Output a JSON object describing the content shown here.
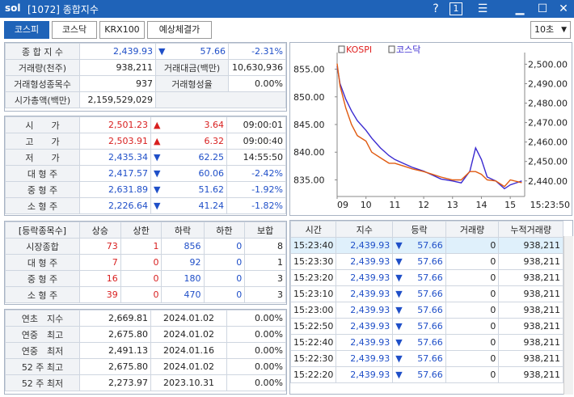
{
  "window": {
    "logo": "sol",
    "title": "[1072] 종합지수",
    "help": "?",
    "page_indicator": "1"
  },
  "tabs": [
    {
      "label": "코스피",
      "active": true
    },
    {
      "label": "코스닥"
    },
    {
      "label": "KRX100"
    },
    {
      "label": "예상체결가"
    }
  ],
  "interval": {
    "selected": "10초"
  },
  "summary": {
    "row1": {
      "label": "종 합 지 수",
      "value": "2,439.93",
      "change": "57.66",
      "rate": "-2.31%"
    },
    "row2": {
      "label1": "거래량(천주)",
      "value1": "938,211",
      "label2": "거래대금(백만)",
      "value2": "10,630,936"
    },
    "row3": {
      "label1": "거래형성종목수",
      "value1": "937",
      "label2": "거래형성율",
      "value2": "0.00%"
    },
    "row4": {
      "label": "시가총액(백만)",
      "value": "2,159,529,029"
    }
  },
  "ohlc": [
    {
      "label": "시　　가",
      "value": "2,501.23",
      "dir": "up",
      "change": "3.64",
      "extra": "09:00:01"
    },
    {
      "label": "고　　가",
      "value": "2,503.91",
      "dir": "up",
      "change": "6.32",
      "extra": "09:00:40"
    },
    {
      "label": "저　　가",
      "value": "2,435.34",
      "dir": "down",
      "change": "62.25",
      "extra": "14:55:50"
    },
    {
      "label": "대 형 주",
      "value": "2,417.57",
      "dir": "down",
      "change": "60.06",
      "extra": "-2.42%"
    },
    {
      "label": "중 형 주",
      "value": "2,631.89",
      "dir": "down",
      "change": "51.62",
      "extra": "-1.92%"
    },
    {
      "label": "소 형 주",
      "value": "2,226.64",
      "dir": "down",
      "change": "41.24",
      "extra": "-1.82%"
    }
  ],
  "breadth": {
    "headers": [
      "[등락종목수]",
      "상승",
      "상한",
      "하락",
      "하한",
      "보합"
    ],
    "rows": [
      [
        "시장종합",
        "73",
        "1",
        "856",
        "0",
        "8"
      ],
      [
        "대 형 주",
        "7",
        "0",
        "92",
        "0",
        "1"
      ],
      [
        "중 형 주",
        "16",
        "0",
        "180",
        "0",
        "3"
      ],
      [
        "소 형 주",
        "39",
        "0",
        "470",
        "0",
        "3"
      ]
    ]
  },
  "yearly": [
    {
      "label": "연초　지수",
      "value": "2,669.81",
      "date": "2024.01.02",
      "rate": "0.00%"
    },
    {
      "label": "연중　최고",
      "value": "2,675.80",
      "date": "2024.01.02",
      "rate": "0.00%"
    },
    {
      "label": "연중　최저",
      "value": "2,491.13",
      "date": "2024.01.16",
      "rate": "0.00%"
    },
    {
      "label": "52 주 최고",
      "value": "2,675.80",
      "date": "2024.01.02",
      "rate": "0.00%"
    },
    {
      "label": "52 주 최저",
      "value": "2,273.97",
      "date": "2023.10.31",
      "rate": "0.00%"
    }
  ],
  "ticks": {
    "headers": [
      "시간",
      "지수",
      "등락",
      "거래량",
      "누적거래량"
    ],
    "rows": [
      {
        "time": "15:23:40",
        "index": "2,439.93",
        "change": "57.66",
        "volume": "0",
        "cum": "938,211"
      },
      {
        "time": "15:23:30",
        "index": "2,439.93",
        "change": "57.66",
        "volume": "0",
        "cum": "938,211"
      },
      {
        "time": "15:23:20",
        "index": "2,439.93",
        "change": "57.66",
        "volume": "0",
        "cum": "938,211"
      },
      {
        "time": "15:23:10",
        "index": "2,439.93",
        "change": "57.66",
        "volume": "0",
        "cum": "938,211"
      },
      {
        "time": "15:23:00",
        "index": "2,439.93",
        "change": "57.66",
        "volume": "0",
        "cum": "938,211"
      },
      {
        "time": "15:22:50",
        "index": "2,439.93",
        "change": "57.66",
        "volume": "0",
        "cum": "938,211"
      },
      {
        "time": "15:22:40",
        "index": "2,439.93",
        "change": "57.66",
        "volume": "0",
        "cum": "938,211"
      },
      {
        "time": "15:22:30",
        "index": "2,439.93",
        "change": "57.66",
        "volume": "0",
        "cum": "938,211"
      },
      {
        "time": "15:22:20",
        "index": "2,439.93",
        "change": "57.66",
        "volume": "0",
        "cum": "938,211"
      }
    ]
  },
  "chart_data": {
    "type": "line",
    "legend": [
      "KOSPI",
      "코스닥"
    ],
    "left_axis": {
      "ticks": [
        "855.00",
        "850.00",
        "845.00",
        "840.00",
        "835.00"
      ],
      "values": [
        855,
        850,
        845,
        840,
        835
      ]
    },
    "right_axis": {
      "ticks": [
        "2,500.00",
        "2,490.00",
        "2,480.00",
        "2,470.00",
        "2,460.00",
        "2,450.00",
        "2,440.00"
      ],
      "values": [
        2500,
        2490,
        2480,
        2470,
        2460,
        2450,
        2440
      ]
    },
    "x_ticks": [
      "09",
      "10",
      "11",
      "12",
      "13",
      "14",
      "15",
      "15:23:50"
    ],
    "series": [
      {
        "name": "KOSPI",
        "color": "#3a2ad0",
        "axis": "right",
        "points": [
          [
            9.0,
            2499
          ],
          [
            9.1,
            2490
          ],
          [
            9.3,
            2482
          ],
          [
            9.5,
            2476
          ],
          [
            9.7,
            2471
          ],
          [
            10.0,
            2466
          ],
          [
            10.2,
            2462
          ],
          [
            10.5,
            2457
          ],
          [
            10.8,
            2453
          ],
          [
            11.0,
            2451
          ],
          [
            11.3,
            2449
          ],
          [
            11.6,
            2447
          ],
          [
            12.0,
            2445
          ],
          [
            12.3,
            2443
          ],
          [
            12.6,
            2441
          ],
          [
            13.0,
            2440
          ],
          [
            13.3,
            2439
          ],
          [
            13.6,
            2445
          ],
          [
            13.8,
            2457
          ],
          [
            14.0,
            2451
          ],
          [
            14.2,
            2442
          ],
          [
            14.5,
            2440
          ],
          [
            14.8,
            2436
          ],
          [
            15.0,
            2438
          ],
          [
            15.4,
            2440
          ]
        ]
      },
      {
        "name": "코스닥",
        "color": "#e05a10",
        "axis": "left",
        "points": [
          [
            9.0,
            856
          ],
          [
            9.1,
            852
          ],
          [
            9.3,
            848
          ],
          [
            9.5,
            845
          ],
          [
            9.7,
            843
          ],
          [
            10.0,
            842
          ],
          [
            10.2,
            840
          ],
          [
            10.5,
            839
          ],
          [
            10.8,
            838
          ],
          [
            11.0,
            838
          ],
          [
            11.3,
            837.5
          ],
          [
            11.6,
            837
          ],
          [
            12.0,
            836.5
          ],
          [
            12.3,
            836
          ],
          [
            12.6,
            835.5
          ],
          [
            13.0,
            835
          ],
          [
            13.3,
            835
          ],
          [
            13.6,
            836.5
          ],
          [
            13.8,
            836.5
          ],
          [
            14.0,
            836
          ],
          [
            14.2,
            835
          ],
          [
            14.5,
            834.8
          ],
          [
            14.8,
            833.8
          ],
          [
            15.0,
            835
          ],
          [
            15.4,
            834.5
          ]
        ]
      }
    ]
  }
}
